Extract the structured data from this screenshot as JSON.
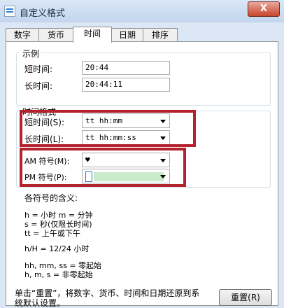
{
  "window": {
    "title": "自定义格式",
    "close": "X"
  },
  "tabs": [
    {
      "label": "数字"
    },
    {
      "label": "货币"
    },
    {
      "label": "时间"
    },
    {
      "label": "日期"
    },
    {
      "label": "排序"
    }
  ],
  "example": {
    "title": "示例",
    "short_label": "短时间:",
    "short_value": "20:44",
    "long_label": "长时间:",
    "long_value": "20:44:11"
  },
  "formats": {
    "title": "时间格式",
    "short_label": "短时间(S):",
    "short_value": "tt hh:mm",
    "long_label": "长时间(L):",
    "long_value": "tt hh:mm:ss",
    "am_label": "AM 符号(M):",
    "am_value": "♥",
    "pm_label": "PM 符号(P):",
    "pm_value": ""
  },
  "meaning": {
    "title": "各符号的含义:",
    "lines": [
      "h = 小时   m = 分钟",
      "s = 秒(仅限长时间)",
      "tt = 上午或下午",
      "h/H = 12/24 小时",
      "hh, mm, ss = 零起始",
      "h, m, s = 非零起始"
    ]
  },
  "footer": {
    "note_line1": "单击“重置”，将数字、货币、时间和日期还原到系",
    "note_line2": "统默认设置。",
    "reset_label": "重置(R)"
  },
  "colors": {
    "highlight": "#b4222d",
    "tab_border": "#8e8f8f"
  }
}
